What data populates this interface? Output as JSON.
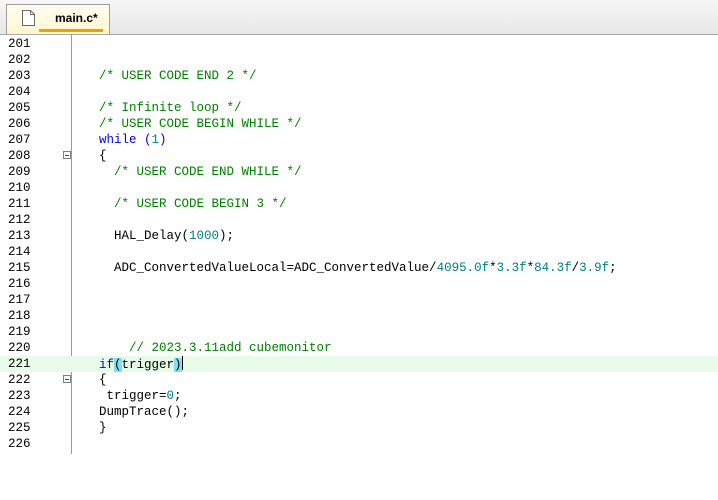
{
  "tab": {
    "label": "main.c*"
  },
  "lines": [
    {
      "num": "201",
      "code": ""
    },
    {
      "num": "202",
      "code": ""
    },
    {
      "num": "203",
      "code": "/* USER CODE END 2 */"
    },
    {
      "num": "204",
      "code": ""
    },
    {
      "num": "205",
      "code": "/* Infinite loop */"
    },
    {
      "num": "206",
      "code": "/* USER CODE BEGIN WHILE */"
    },
    {
      "num": "207",
      "code": "while (1)"
    },
    {
      "num": "208",
      "code": "{"
    },
    {
      "num": "209",
      "code": "  /* USER CODE END WHILE */"
    },
    {
      "num": "210",
      "code": ""
    },
    {
      "num": "211",
      "code": "  /* USER CODE BEGIN 3 */"
    },
    {
      "num": "212",
      "code": ""
    },
    {
      "num": "213",
      "code": "  HAL_Delay(1000);"
    },
    {
      "num": "214",
      "code": ""
    },
    {
      "num": "215",
      "code": "  ADC_ConvertedValueLocal=ADC_ConvertedValue/4095.0f*3.3f*84.3f/3.9f;"
    },
    {
      "num": "216",
      "code": ""
    },
    {
      "num": "217",
      "code": ""
    },
    {
      "num": "218",
      "code": ""
    },
    {
      "num": "219",
      "code": ""
    },
    {
      "num": "220",
      "code": "    // 2023.3.11add cubemonitor"
    },
    {
      "num": "221",
      "code": "if(trigger)"
    },
    {
      "num": "222",
      "code": "{"
    },
    {
      "num": "223",
      "code": " trigger=0;"
    },
    {
      "num": "224",
      "code": "DumpTrace();"
    },
    {
      "num": "225",
      "code": "}"
    },
    {
      "num": "226",
      "code": ""
    }
  ],
  "current_line": "221",
  "colors": {
    "comment": "#008000",
    "keyword": "#0000ff",
    "number": "#008080",
    "current_line_bg": "#e8fbe8",
    "brace_match": "#7fe0f0"
  }
}
